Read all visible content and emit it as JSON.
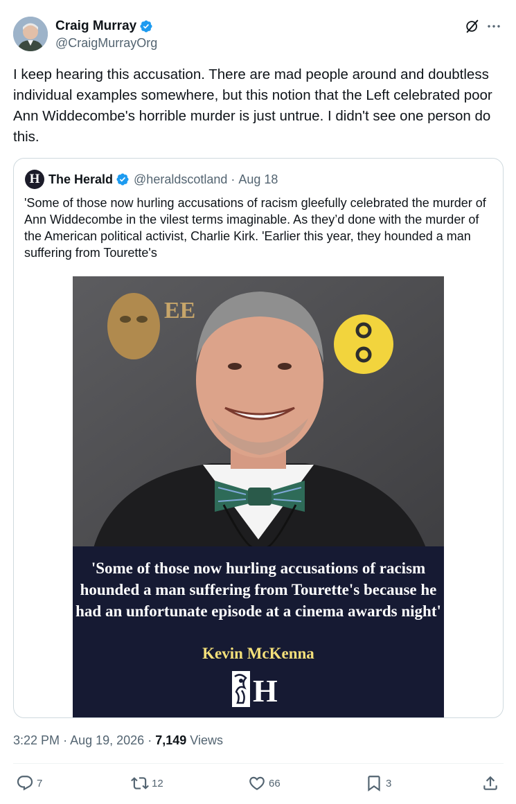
{
  "author": {
    "display_name": "Craig Murray",
    "handle": "@CraigMurrayOrg"
  },
  "icons": {
    "verified": "verified-badge-icon",
    "grok": "grok-icon",
    "more": "more-options-icon"
  },
  "tweet": {
    "text": "I keep hearing this accusation.  There are mad people around and doubtless individual examples somewhere, but this notion that the Left celebrated poor Ann Widdecombe's horrible murder is just untrue. I didn't see one person do this."
  },
  "quote": {
    "avatar_letter": "H",
    "display_name": "The Herald",
    "handle": "@heraldscotland",
    "separator": "·",
    "date": "Aug 18",
    "text": "'Some of those now hurling accusations of racism gleefully celebrated the murder of Ann Widdecombe in the vilest terms imaginable. As they’d done with the murder of the American political activist, Charlie Kirk.  'Earlier this year, they hounded a man suffering from Tourette's",
    "media": {
      "backdrop_text": "EE",
      "caption": "'Some of those now hurling accusations of racism hounded a man suffering from Tourette's because he had an unfortunate episode at a cinema awards night'",
      "caption_author": "Kevin McKenna",
      "logo_letter": "H"
    }
  },
  "meta": {
    "time": "3:22 PM",
    "sep1": "·",
    "date": "Aug 19, 2026",
    "sep2": "·",
    "views_count": "7,149",
    "views_label": "Views"
  },
  "actions": {
    "replies": "7",
    "reposts": "12",
    "likes": "66",
    "bookmarks": "3"
  },
  "colors": {
    "text": "#0f1419",
    "secondary": "#536471",
    "verified": "#1d9bf0",
    "border": "#cfd9de",
    "caption_bg": "#161a33",
    "caption_author": "#f4e07a"
  }
}
